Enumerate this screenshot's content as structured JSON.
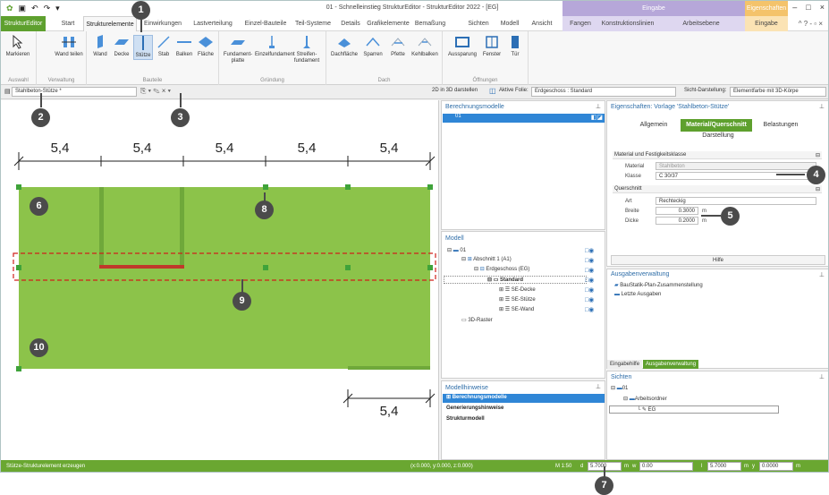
{
  "window": {
    "title": "01 - Schnelleinstieg StrukturEditor - StrukturEditor 2022 - [EG]",
    "context_eingabe": "Eingabe",
    "context_eigenschaften": "Eigenschaften",
    "controls": [
      "–",
      "□",
      "×"
    ]
  },
  "tabs": [
    "StrukturEditor",
    "Start",
    "Strukturelemente",
    "Einwirkungen",
    "Lastverteilung",
    "Einzel-Bauteile",
    "Teil-Systeme",
    "Details",
    "Grafikelemente",
    "Bemaßung",
    "Sichten",
    "Modell",
    "Ansicht",
    "Fangen",
    "Konstruktionslinien",
    "Arbeitsebene",
    "Eingabe"
  ],
  "ribbon": {
    "groups": [
      {
        "label": "Auswahl",
        "buttons": [
          "Markieren"
        ]
      },
      {
        "label": "Verwaltung",
        "buttons": [
          "Wand teilen"
        ]
      },
      {
        "label": "Bauteile",
        "buttons": [
          "Wand",
          "Decke",
          "Stütze",
          "Stab",
          "Balken",
          "Fläche"
        ]
      },
      {
        "label": "Gründung",
        "buttons": [
          "Fundament-platte",
          "Einzelfundament",
          "Streifen-fundament"
        ]
      },
      {
        "label": "Dach",
        "buttons": [
          "Dachfläche",
          "Sparren",
          "Pfette",
          "Kehlbalken"
        ]
      },
      {
        "label": "Öffnungen",
        "buttons": [
          "Aussparung",
          "Fenster",
          "Tür"
        ]
      }
    ]
  },
  "toolbar": {
    "template_select": "Stahlbeton-Stütze *",
    "view_2d3d": "2D in 3D darstellen",
    "active_layer_label": "Aktive Folie:",
    "active_layer_value": "Erdgeschoss : Standard",
    "display_label": "Sicht-Darstellung:",
    "display_value": "Elementfarbe mit 3D-Körpe"
  },
  "canvas": {
    "dimensions_top": [
      "5,4",
      "5,4",
      "5,4",
      "5,4",
      "5,4"
    ],
    "dimension_bottom": "5,4"
  },
  "berechnungsmodelle": {
    "title": "Berechnungsmodelle",
    "items": [
      "01"
    ]
  },
  "modell": {
    "title": "Modell",
    "items": [
      "01",
      "Abschnitt 1 (A1)",
      "Erdgeschoss (EG)",
      "Standard",
      "SE-Decke",
      "SE-Stütze",
      "SE-Wand",
      "3D-Raster"
    ]
  },
  "modellhinweise": {
    "title": "Modellhinweise",
    "items": [
      "Berechnungsmodelle",
      "Generierungshinweise",
      "Strukturmodell"
    ]
  },
  "properties": {
    "title": "Eigenschaften: Vorlage 'Stahlbeton-Stütze'",
    "tabs": [
      "Allgemein",
      "Material/Querschnitt",
      "Belastungen",
      "Darstellung"
    ],
    "section_material": "Material und Festigkeitsklasse",
    "material_label": "Material",
    "material_value": "Stahlbeton",
    "klasse_label": "Klasse",
    "klasse_value": "C 30/37",
    "section_querschnitt": "Querschnitt",
    "art_label": "Art",
    "art_value": "Rechteckig",
    "breite_label": "Breite",
    "breite_value": "0.3000",
    "dicke_label": "Dicke",
    "dicke_value": "0.2000",
    "unit": "m",
    "help_button": "Hilfe"
  },
  "ausgabe": {
    "title": "Ausgabenverwaltung",
    "items": [
      "BauStatik-Plan-Zusammenstellung",
      "Letzte Ausgaben"
    ]
  },
  "bottom_tabs": [
    "Eingabehilfe",
    "Ausgabenverwaltung"
  ],
  "sichten": {
    "title": "Sichten",
    "items": [
      "01",
      "Arbeitsordner",
      "EG"
    ]
  },
  "status": {
    "message": "Stütze-Strukturelement erzeugen",
    "coords": "(x:0.000, y:0.000, z:0.000)",
    "scale": "M 1:50",
    "d_label": "d",
    "d_value": "5.7000",
    "m1": "m",
    "w_label": "w",
    "w_value": "0.00",
    "l_label": "l",
    "l_value": "5.7000",
    "m2": "m",
    "y_label": "y",
    "y_value": "0.0000",
    "m3": "m"
  },
  "callouts": [
    "1",
    "2",
    "3",
    "4",
    "5",
    "6",
    "7",
    "8",
    "9",
    "10"
  ],
  "colors": {
    "accent": "#5ea02e",
    "slab": "#8cc34a",
    "wall": "#c0392b",
    "selection": "#2f86d6",
    "callout": "#4b4b4b"
  }
}
